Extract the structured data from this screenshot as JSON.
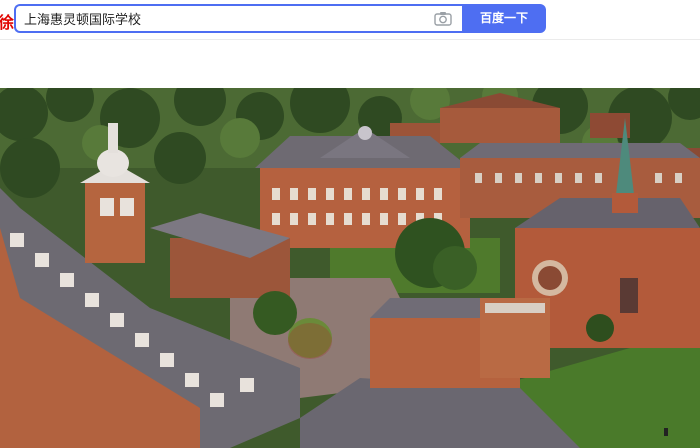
{
  "header": {
    "logo_fragment": "徐",
    "search_value": "上海惠灵顿国际学校",
    "search_button": "百度一下",
    "camera_icon": "camera-icon"
  },
  "colors": {
    "accent": "#4e6ef2",
    "logo_red": "#e10602"
  },
  "photo": {
    "subject": "aerial-view-school-campus"
  }
}
